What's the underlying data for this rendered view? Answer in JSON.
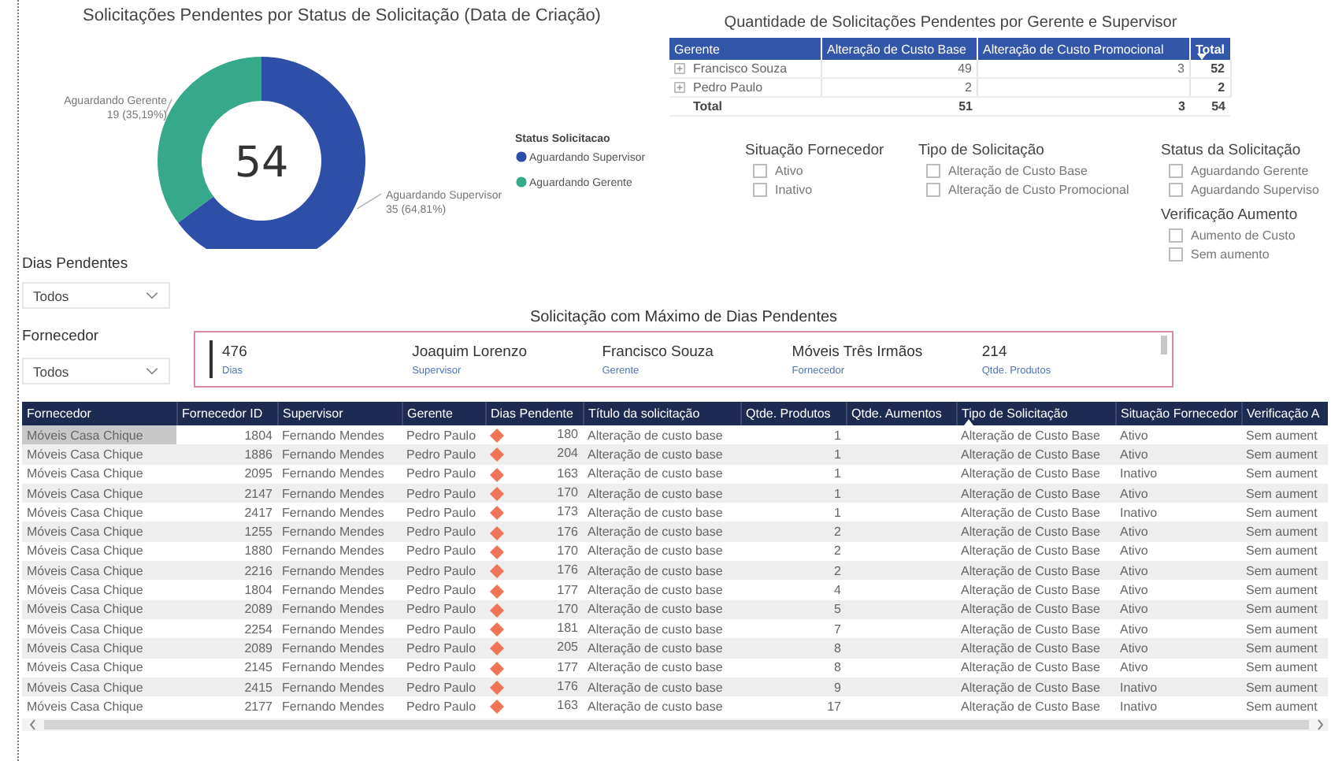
{
  "donut": {
    "title": "Solicitações Pendentes por Status de Solicitação (Data de Criação)",
    "total": "54",
    "chart_data": {
      "type": "donut",
      "categories": [
        "Aguardando Supervisor",
        "Aguardando Gerente"
      ],
      "series": [
        {
          "values": [
            64.81,
            35.19
          ]
        }
      ],
      "value_labels": [
        "35 (64,81%)",
        "19 (35,19%)"
      ]
    },
    "legend": {
      "title": "Status Solicitacao",
      "items": [
        {
          "label": "Aguardando Supervisor",
          "color": "#2e4fa7"
        },
        {
          "label": "Aguardando Gerente",
          "color": "#37a98b"
        }
      ]
    }
  },
  "dropdowns": [
    {
      "label": "Dias Pendentes",
      "value": "Todos"
    },
    {
      "label": "Fornecedor",
      "value": "Todos"
    }
  ],
  "matrix": {
    "title": "Quantidade de Solicitações Pendentes por Gerente e Supervisor",
    "columns": [
      {
        "label": "Gerente",
        "kind": "text",
        "sorted": false
      },
      {
        "label": "Alteração de Custo Base",
        "kind": "number",
        "sorted": false
      },
      {
        "label": "Alteração de Custo Promocional",
        "kind": "number",
        "sorted": false
      },
      {
        "label": "Total",
        "kind": "number",
        "sorted": true,
        "descending": true
      }
    ],
    "rows": [
      {
        "kind": "group",
        "cells": [
          "Francisco Souza",
          "49",
          "3",
          "52"
        ]
      },
      {
        "kind": "group",
        "cells": [
          "Pedro Paulo",
          "2",
          null,
          "2"
        ]
      },
      {
        "kind": "total",
        "cells": [
          "Total",
          "51",
          "3",
          "54"
        ]
      }
    ]
  },
  "checklists": [
    {
      "title": "Situação Fornecedor",
      "options": [
        {
          "label": "Ativo",
          "checked": false
        },
        {
          "label": "Inativo",
          "checked": false
        }
      ]
    },
    {
      "title": "Tipo de Solicitação",
      "options": [
        {
          "label": "Alteração de Custo Base",
          "checked": false
        },
        {
          "label": "Alteração de Custo Promocional",
          "checked": false
        }
      ]
    },
    {
      "title": "Status da Solicitação",
      "options": [
        {
          "label": "Aguardando Gerente",
          "checked": false
        },
        {
          "label": "Aguardando Superviso",
          "checked": false
        }
      ]
    },
    {
      "title": "Verificação Aumento",
      "options": [
        {
          "label": "Aumento de Custo",
          "checked": false
        },
        {
          "label": "Sem aumento",
          "checked": false
        }
      ]
    }
  ],
  "card": {
    "title": "Solicitação com Máximo de Dias Pendentes",
    "fields": [
      {
        "value": "476",
        "label": "Dias"
      },
      {
        "value": "Joaquim Lorenzo",
        "label": "Supervisor"
      },
      {
        "value": "Francisco Souza",
        "label": "Gerente"
      },
      {
        "value": "Móveis Três Irmãos",
        "label": "Fornecedor"
      },
      {
        "value": "214",
        "label": "Qtde. Produtos"
      }
    ]
  },
  "table": {
    "columns": [
      {
        "label": "Fornecedor",
        "kind": "text",
        "sorted": false
      },
      {
        "label": "Fornecedor ID",
        "kind": "number",
        "sorted": false
      },
      {
        "label": "Supervisor",
        "kind": "text",
        "sorted": false
      },
      {
        "label": "Gerente",
        "kind": "text",
        "sorted": false
      },
      {
        "label": "Dias Pendente",
        "kind": "indicator",
        "sorted": false
      },
      {
        "label": "Título da solicitação",
        "kind": "text",
        "sorted": false
      },
      {
        "label": "Qtde. Produtos",
        "kind": "number",
        "sorted": false
      },
      {
        "label": "Qtde. Aumentos",
        "kind": "number",
        "sorted": false
      },
      {
        "label": "Tipo de Solicitação",
        "kind": "text",
        "sorted": true,
        "descending": false
      },
      {
        "label": "Situação Fornecedor",
        "kind": "text",
        "sorted": false
      },
      {
        "label": "Verificação A",
        "kind": "text",
        "sorted": false
      }
    ],
    "rows": [
      {
        "selected": true,
        "cells": [
          "Móveis Casa Chique",
          "1804",
          "Fernando Mendes",
          "Pedro Paulo",
          "180",
          "Alteração de custo base",
          "1",
          null,
          "Alteração de Custo Base",
          "Ativo",
          "Sem aument"
        ]
      },
      {
        "selected": false,
        "cells": [
          "Móveis Casa Chique",
          "1886",
          "Fernando Mendes",
          "Pedro Paulo",
          "204",
          "Alteração de custo base",
          "1",
          null,
          "Alteração de Custo Base",
          "Ativo",
          "Sem aument"
        ]
      },
      {
        "selected": false,
        "cells": [
          "Móveis Casa Chique",
          "2095",
          "Fernando Mendes",
          "Pedro Paulo",
          "163",
          "Alteração de custo base",
          "1",
          null,
          "Alteração de Custo Base",
          "Inativo",
          "Sem aument"
        ]
      },
      {
        "selected": false,
        "cells": [
          "Móveis Casa Chique",
          "2147",
          "Fernando Mendes",
          "Pedro Paulo",
          "170",
          "Alteração de custo base",
          "1",
          null,
          "Alteração de Custo Base",
          "Ativo",
          "Sem aument"
        ]
      },
      {
        "selected": false,
        "cells": [
          "Móveis Casa Chique",
          "2417",
          "Fernando Mendes",
          "Pedro Paulo",
          "173",
          "Alteração de custo base",
          "1",
          null,
          "Alteração de Custo Base",
          "Inativo",
          "Sem aument"
        ]
      },
      {
        "selected": false,
        "cells": [
          "Móveis Casa Chique",
          "1255",
          "Fernando Mendes",
          "Pedro Paulo",
          "176",
          "Alteração de custo base",
          "2",
          null,
          "Alteração de Custo Base",
          "Ativo",
          "Sem aument"
        ]
      },
      {
        "selected": false,
        "cells": [
          "Móveis Casa Chique",
          "1880",
          "Fernando Mendes",
          "Pedro Paulo",
          "170",
          "Alteração de custo base",
          "2",
          null,
          "Alteração de Custo Base",
          "Ativo",
          "Sem aument"
        ]
      },
      {
        "selected": false,
        "cells": [
          "Móveis Casa Chique",
          "2216",
          "Fernando Mendes",
          "Pedro Paulo",
          "176",
          "Alteração de custo base",
          "2",
          null,
          "Alteração de Custo Base",
          "Ativo",
          "Sem aument"
        ]
      },
      {
        "selected": false,
        "cells": [
          "Móveis Casa Chique",
          "1804",
          "Fernando Mendes",
          "Pedro Paulo",
          "177",
          "Alteração de custo base",
          "4",
          null,
          "Alteração de Custo Base",
          "Ativo",
          "Sem aument"
        ]
      },
      {
        "selected": false,
        "cells": [
          "Móveis Casa Chique",
          "2089",
          "Fernando Mendes",
          "Pedro Paulo",
          "170",
          "Alteração de custo base",
          "5",
          null,
          "Alteração de Custo Base",
          "Ativo",
          "Sem aument"
        ]
      },
      {
        "selected": false,
        "cells": [
          "Móveis Casa Chique",
          "2254",
          "Fernando Mendes",
          "Pedro Paulo",
          "181",
          "Alteração de custo base",
          "7",
          null,
          "Alteração de Custo Base",
          "Ativo",
          "Sem aument"
        ]
      },
      {
        "selected": false,
        "cells": [
          "Móveis Casa Chique",
          "2089",
          "Fernando Mendes",
          "Pedro Paulo",
          "205",
          "Alteração de custo base",
          "8",
          null,
          "Alteração de Custo Base",
          "Ativo",
          "Sem aument"
        ]
      },
      {
        "selected": false,
        "cells": [
          "Móveis Casa Chique",
          "2145",
          "Fernando Mendes",
          "Pedro Paulo",
          "177",
          "Alteração de custo base",
          "8",
          null,
          "Alteração de Custo Base",
          "Ativo",
          "Sem aument"
        ]
      },
      {
        "selected": false,
        "cells": [
          "Móveis Casa Chique",
          "2415",
          "Fernando Mendes",
          "Pedro Paulo",
          "176",
          "Alteração de custo base",
          "9",
          null,
          "Alteração de Custo Base",
          "Inativo",
          "Sem aument"
        ]
      },
      {
        "selected": false,
        "cells": [
          "Móveis Casa Chique",
          "2177",
          "Fernando Mendes",
          "Pedro Paulo",
          "163",
          "Alteração de custo base",
          "17",
          null,
          "Alteração de Custo Base",
          "Inativo",
          "Sem aument"
        ]
      }
    ]
  }
}
